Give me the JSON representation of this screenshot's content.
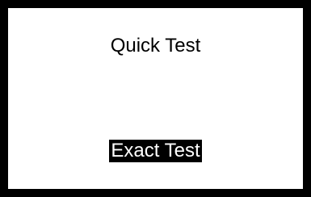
{
  "menu": {
    "options": [
      {
        "label": "Quick Test",
        "selected": false
      },
      {
        "label": "Exact Test",
        "selected": true
      }
    ]
  },
  "colors": {
    "frame": "#000000",
    "background": "#ffffff",
    "highlight_bg": "#000000",
    "highlight_text": "#ffffff"
  }
}
